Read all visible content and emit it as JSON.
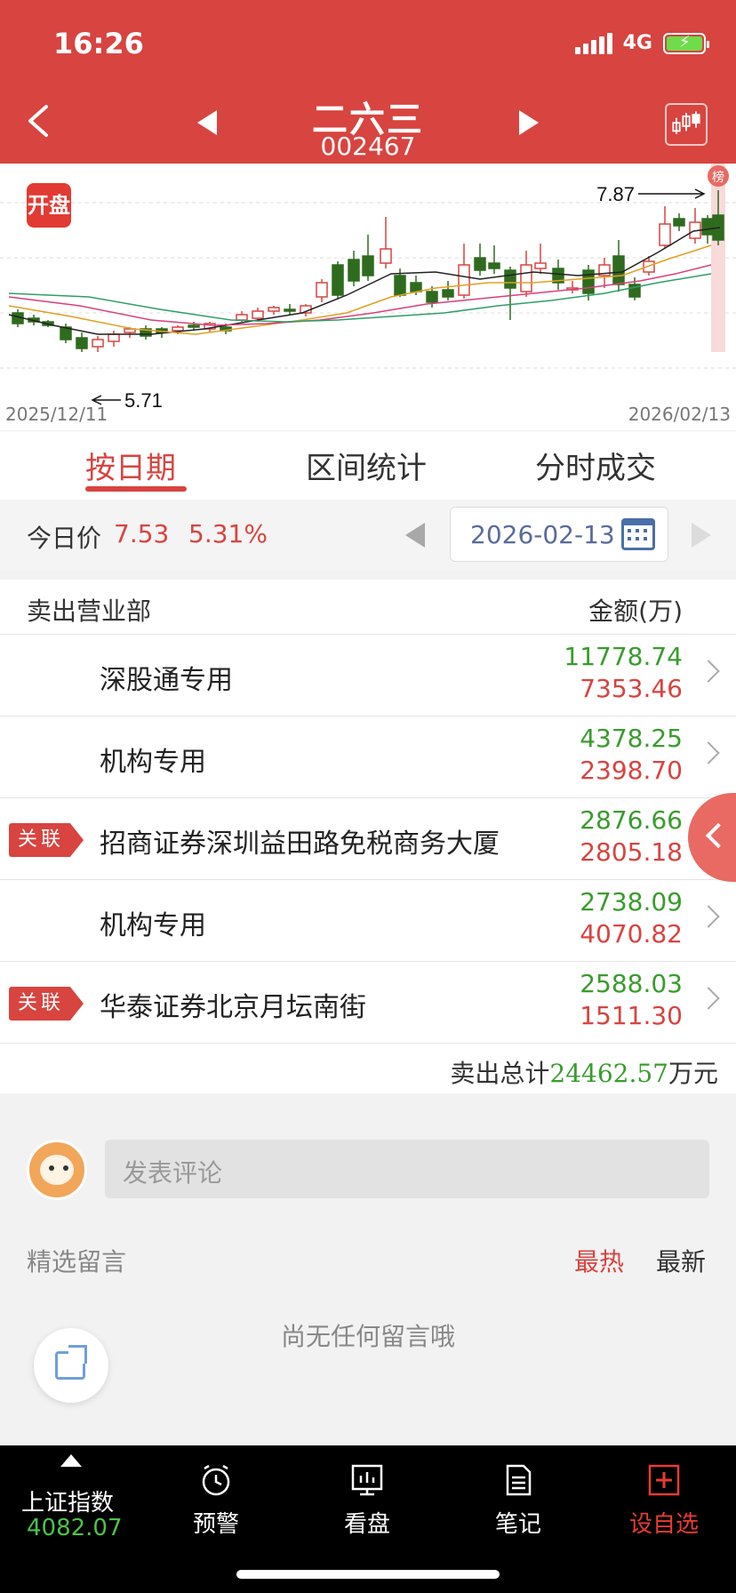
{
  "status": {
    "time": "16:26",
    "network": "4G"
  },
  "header": {
    "name": "二六三",
    "code": "002467"
  },
  "chart": {
    "badge": "开盘",
    "start_date": "2025/12/11",
    "end_date": "2026/02/13",
    "low_label": "5.71",
    "high_label": "7.87",
    "rank_tag": "榜"
  },
  "chart_data": {
    "type": "candlestick",
    "x": [
      "2025/12/11",
      "2026/02/13"
    ],
    "annotations": [
      {
        "text": "5.71",
        "kind": "period-low"
      },
      {
        "text": "7.87",
        "kind": "period-high"
      }
    ],
    "series": [
      {
        "kind": "moving-average",
        "color": "#222222"
      },
      {
        "kind": "moving-average",
        "color": "#e0a020"
      },
      {
        "kind": "moving-average",
        "color": "#d9407a"
      },
      {
        "kind": "moving-average",
        "color": "#2f9e6a"
      }
    ],
    "up_color": "#d84440",
    "down_color": "#2f6b1f",
    "grid": true
  },
  "tabs": [
    {
      "label": "按日期",
      "active": true
    },
    {
      "label": "区间统计",
      "active": false
    },
    {
      "label": "分时成交",
      "active": false
    }
  ],
  "price": {
    "label": "今日价",
    "value": "7.53",
    "change_pct": "5.31%",
    "date": "2026-02-13"
  },
  "table": {
    "col_left": "卖出营业部",
    "col_right": "金额(万)",
    "rows": [
      {
        "tag": "",
        "name": "深股通专用",
        "buy": "11778.74",
        "sell": "7353.46"
      },
      {
        "tag": "",
        "name": "机构专用",
        "buy": "4378.25",
        "sell": "2398.70"
      },
      {
        "tag": "关联",
        "name": "招商证券深圳益田路免税商务大厦",
        "buy": "2876.66",
        "sell": "2805.18"
      },
      {
        "tag": "",
        "name": "机构专用",
        "buy": "2738.09",
        "sell": "4070.82"
      },
      {
        "tag": "关联",
        "name": "华泰证券北京月坛南街",
        "buy": "2588.03",
        "sell": "1511.30"
      }
    ],
    "total_prefix": "卖出总计",
    "total_value": "24462.57",
    "total_suffix": "万元"
  },
  "comments": {
    "placeholder": "发表评论",
    "featured": "精选留言",
    "hot": "最热",
    "newest": "最新",
    "empty": "尚无任何留言哦"
  },
  "nav": {
    "index_label": "上证指数",
    "index_value": "4082.07",
    "alert": "预警",
    "watch": "看盘",
    "notes": "笔记",
    "add": "设自选",
    "add_color": "#e83b32",
    "index_value_color": "#4cc24a"
  },
  "colors": {
    "brand": "#d84440",
    "up": "#d84440",
    "down": "#3a9c2e"
  }
}
